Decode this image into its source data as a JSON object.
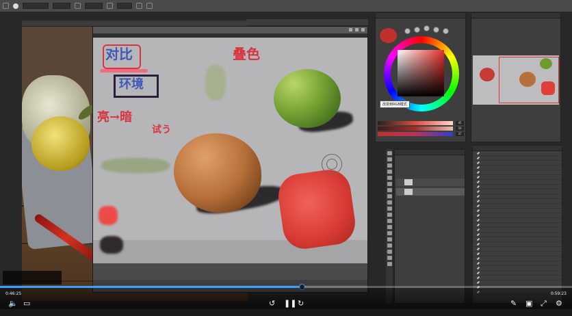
{
  "canvas_annotations": {
    "contrast": "对比",
    "color_stacking": "叠色",
    "environment": "环境",
    "light_to_dark": "亮→暗",
    "try_it": "试う"
  },
  "color_panel": {
    "tooltip": "改变到RGB模式",
    "values": [
      "45",
      "50",
      "37"
    ]
  },
  "player": {
    "current_time": "0:46:25",
    "duration": "0:59:23",
    "progress_fraction": 0.528
  },
  "colors": {
    "accent_progress": "#3aa0ff",
    "annotation_red": "#d8343f",
    "annotation_blue": "#3f57b8",
    "foreground": "#c0302c"
  },
  "icons": [
    "volume-icon",
    "subtitle-icon",
    "rewind-icon",
    "pause-icon",
    "forward-icon",
    "pen-icon",
    "picture-in-picture-icon",
    "fullscreen-icon",
    "settings-icon"
  ]
}
